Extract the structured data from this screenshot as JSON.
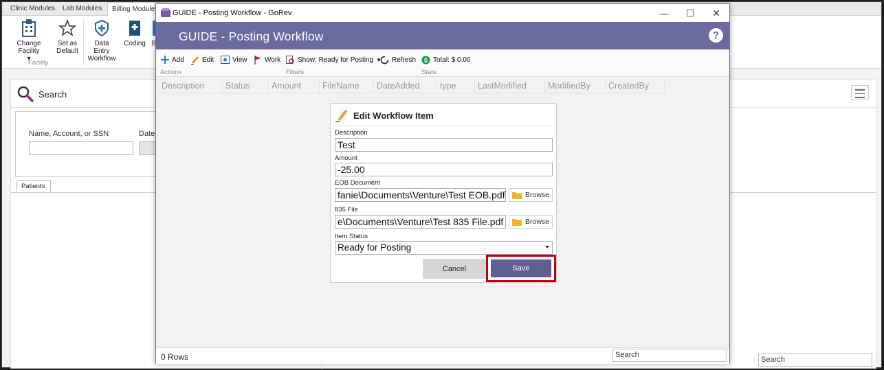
{
  "app": {
    "tabs": [
      "Clinic Modules",
      "Lab Modules",
      "Billing Modules"
    ],
    "ribbon": {
      "change_facility": "Change Facility",
      "set_default_1": "Set as",
      "set_default_2": "Default",
      "data_entry_1": "Data Entry",
      "data_entry_2": "Workflow",
      "coding": "Coding",
      "partial": "B",
      "group_facility": "Facility"
    },
    "search": {
      "title": "Search",
      "field_label": "Name, Account, or SSN",
      "date_label": "Date c",
      "patients_tab": "Patients",
      "bottom_search": "Search"
    }
  },
  "window": {
    "title": "GUIDE - Posting Workflow - GoRev",
    "header_title": "GUIDE - Posting Workflow",
    "help": "?",
    "controls": {
      "minimize": "—",
      "maximize": "☐",
      "close": "✕"
    },
    "toolbar": {
      "add": "Add",
      "edit": "Edit",
      "view": "View",
      "work": "Work",
      "show": "Show: Ready for Posting",
      "refresh": "Refresh",
      "total": "Total: $ 0.00",
      "sections": {
        "actions": "Actions",
        "filters": "Filters",
        "stats": "Stats"
      }
    },
    "columns": [
      "Description",
      "Status",
      "Amount",
      "FileName",
      "DateAdded",
      "type",
      "LastModified",
      "ModifiedBy",
      "CreatedBy"
    ],
    "footer": {
      "rows": "0 Rows",
      "search": "Search"
    }
  },
  "edit_item": {
    "title": "Edit Workflow Item",
    "description_label": "Description",
    "description_value": "Test",
    "amount_label": "Amount",
    "amount_value": "-25.00",
    "eob_label": "EOB Document",
    "eob_value": "fanie\\Documents\\Venture\\Test EOB.pdf",
    "file835_label": "835 File",
    "file835_value": "e\\Documents\\Venture\\Test 835 File.pdf",
    "browse_label": "Browse",
    "status_label": "Item Status",
    "status_value": "Ready for Posting",
    "cancel": "Cancel",
    "save": "Save"
  },
  "colors": {
    "header_band": "#6a6a9e",
    "save_button": "#5f5f92",
    "highlight": "#c00010"
  }
}
